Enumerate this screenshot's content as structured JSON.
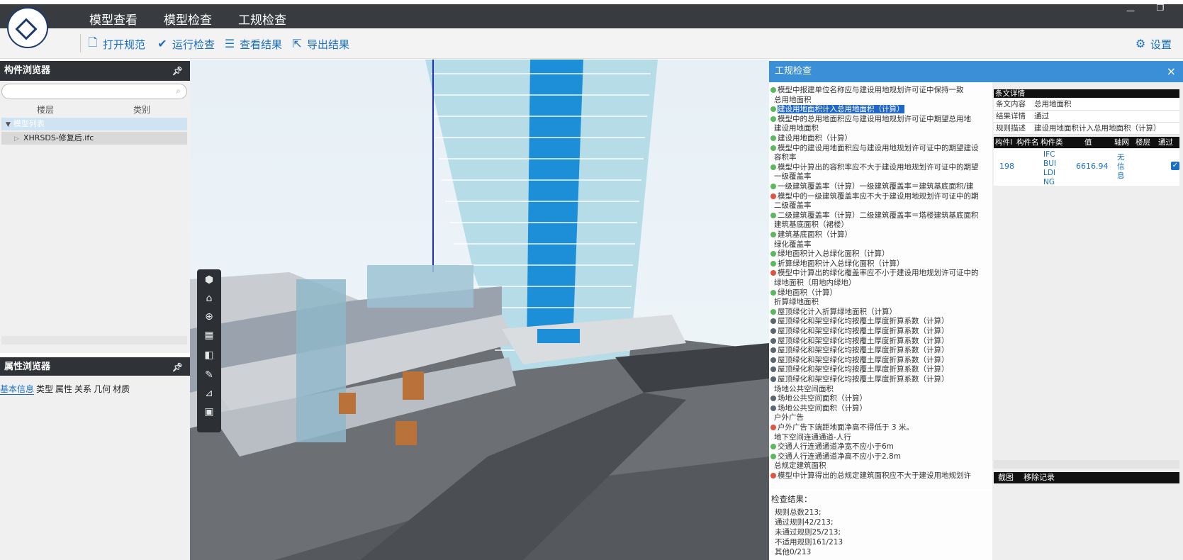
{
  "app": {
    "menu_tabs": [
      "模型查看",
      "模型检查",
      "工规检查"
    ],
    "active_tab": "工规检查",
    "window_controls": [
      "—",
      "❐"
    ]
  },
  "toolbar": {
    "open_rules": "打开规范",
    "run_check": "运行检查",
    "view_results": "查看结果",
    "export_results": "导出结果",
    "settings": "设置"
  },
  "component_browser": {
    "title": "构件浏览器",
    "col_floor": "楼层",
    "col_category": "类别",
    "tree_root": "模型列表",
    "tree_file": "XHRSDS-修复后.ifc"
  },
  "property_browser": {
    "title": "属性浏览器",
    "tabs": [
      "基本信息",
      "类型",
      "属性",
      "关系",
      "几何",
      "材质"
    ]
  },
  "check_panel": {
    "title": "工规检查",
    "close": "×",
    "rules": [
      {
        "text": "模型中报建单位名称应与建设用地规划许可证中保持一致",
        "dot": "green",
        "indent": 0
      },
      {
        "text": "总用地面积",
        "dot": "",
        "indent": 0
      },
      {
        "text": "建设用地面积计入总用地面积（计算）",
        "dot": "green",
        "indent": 0,
        "selected": true
      },
      {
        "text": "模型中的总用地面积应与建设用地规划许可证中期望总用地",
        "dot": "green",
        "indent": 0
      },
      {
        "text": "建设用地面积",
        "dot": "",
        "indent": 0
      },
      {
        "text": "建设用地面积（计算）",
        "dot": "green",
        "indent": 0
      },
      {
        "text": "模型中的建设用地面积应与建设用地规划许可证中的期望建设",
        "dot": "green",
        "indent": 0
      },
      {
        "text": "容积率",
        "dot": "",
        "indent": 0
      },
      {
        "text": "模型中计算出的容积率应不大于建设用地规划许可证中的期望",
        "dot": "green",
        "indent": 0
      },
      {
        "text": "一级覆盖率",
        "dot": "",
        "indent": 0
      },
      {
        "text": "一级建筑覆盖率（计算）一级建筑覆盖率＝建筑基底面积/建",
        "dot": "green",
        "indent": 0
      },
      {
        "text": "模型中的一级建筑覆盖率应不大于建设用地规划许可证中的期",
        "dot": "red",
        "indent": 0
      },
      {
        "text": "二级覆盖率",
        "dot": "",
        "indent": 0
      },
      {
        "text": "二级建筑覆盖率（计算）二级建筑覆盖率＝塔楼建筑基底面积",
        "dot": "green",
        "indent": 0
      },
      {
        "text": "建筑基底面积（裙楼）",
        "dot": "",
        "indent": 0
      },
      {
        "text": "建筑基底面积（计算）",
        "dot": "green",
        "indent": 0
      },
      {
        "text": "绿化覆盖率",
        "dot": "",
        "indent": 0
      },
      {
        "text": "绿地面积计入总绿化面积（计算）",
        "dot": "green",
        "indent": 0
      },
      {
        "text": "折算绿地面积计入总绿化面积（计算）",
        "dot": "green",
        "indent": 0
      },
      {
        "text": "模型中计算出的绿化覆盖率应不小于建设用地规划许可证中的",
        "dot": "red",
        "indent": 0
      },
      {
        "text": "绿地面积（用地内绿地）",
        "dot": "",
        "indent": 0
      },
      {
        "text": "绿地面积（计算）",
        "dot": "green",
        "indent": 0
      },
      {
        "text": "折算绿地面积",
        "dot": "",
        "indent": 0
      },
      {
        "text": "屋顶绿化计入折算绿地面积（计算）",
        "dot": "green",
        "indent": 0
      },
      {
        "text": "屋顶绿化和架空绿化均按覆土厚度折算系数（计算）",
        "dot": "gray",
        "indent": 0
      },
      {
        "text": "屋顶绿化和架空绿化均按覆土厚度折算系数（计算）",
        "dot": "gray",
        "indent": 0
      },
      {
        "text": "屋顶绿化和架空绿化均按覆土厚度折算系数（计算）",
        "dot": "gray",
        "indent": 0
      },
      {
        "text": "屋顶绿化和架空绿化均按覆土厚度折算系数（计算）",
        "dot": "gray",
        "indent": 0
      },
      {
        "text": "屋顶绿化和架空绿化均按覆土厚度折算系数（计算）",
        "dot": "gray",
        "indent": 0
      },
      {
        "text": "屋顶绿化和架空绿化均按覆土厚度折算系数（计算）",
        "dot": "gray",
        "indent": 0
      },
      {
        "text": "屋顶绿化和架空绿化均按覆土厚度折算系数（计算）",
        "dot": "gray",
        "indent": 0
      },
      {
        "text": "场地公共空间面积",
        "dot": "",
        "indent": 0
      },
      {
        "text": "场地公共空间面积（计算）",
        "dot": "gray",
        "indent": 0
      },
      {
        "text": "场地公共空间面积（计算）",
        "dot": "gray",
        "indent": 0
      },
      {
        "text": "户外广告",
        "dot": "",
        "indent": 0
      },
      {
        "text": "户外广告下端距地面净高不得低于 3 米。",
        "dot": "red",
        "indent": 0
      },
      {
        "text": "地下空间连通通道-人行",
        "dot": "",
        "indent": 0
      },
      {
        "text": "交通人行连通通道净宽不应小于6m",
        "dot": "green",
        "indent": 0
      },
      {
        "text": "交通人行连通通道净高不应小于2.8m",
        "dot": "green",
        "indent": 0
      },
      {
        "text": "总规定建筑面积",
        "dot": "",
        "indent": 0
      },
      {
        "text": "模型中计算得出的总规定建筑面积应不大于建设用地规划许",
        "dot": "red",
        "indent": 0
      }
    ],
    "summary_title": "检查结果：",
    "summary_lines": [
      "规则总数213;",
      "通过规则42/213;",
      "未通过规则25/213;",
      "不适用规则161/213",
      "其他0/213"
    ]
  },
  "detail": {
    "header": "条文详情",
    "rows": [
      {
        "k": "条文内容",
        "v": "总用地面积"
      },
      {
        "k": "结果详情",
        "v": "通过"
      },
      {
        "k": "规则描述",
        "v": "建设用地面积计入总用地面积（计算）"
      }
    ],
    "table_cols": [
      "构件I",
      "构件名",
      "构件类",
      "值",
      "轴网",
      "楼层",
      "通过"
    ],
    "row": {
      "id": "198",
      "type": "IFC BUI LDI NG",
      "value": "6616.94",
      "axis": "无 信 息",
      "pass": "✓"
    },
    "bottom_actions": [
      "截图",
      "移除记录"
    ]
  },
  "colors": {
    "topbar": "#383b3f",
    "accent": "#1a6fc2",
    "panel_head": "#3b8fd6",
    "dot_green": "#5cb85c",
    "dot_red": "#e2533f",
    "dot_gray": "#5b6770"
  }
}
